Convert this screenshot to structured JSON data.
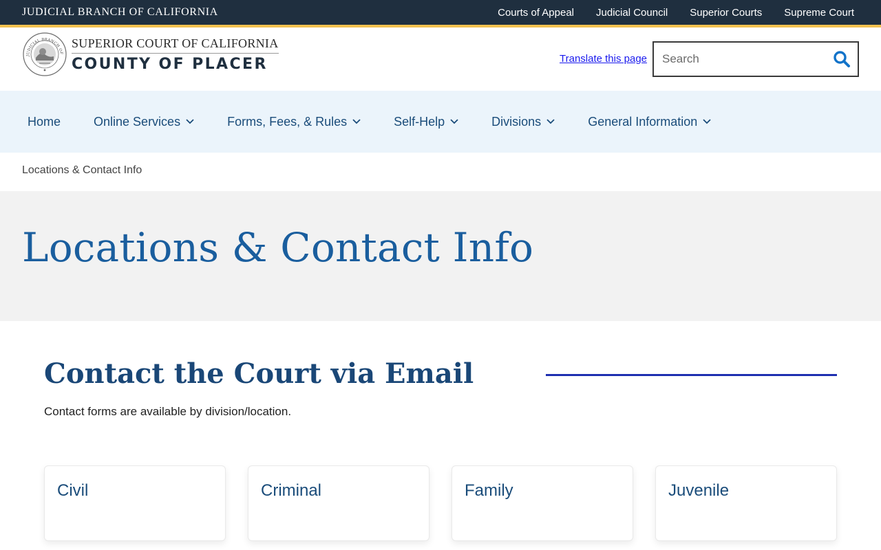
{
  "topbar": {
    "brand": "JUDICIAL BRANCH OF CALIFORNIA",
    "links": [
      "Courts of Appeal",
      "Judicial Council",
      "Superior Courts",
      "Supreme Court"
    ]
  },
  "header": {
    "logo_line1": "SUPERIOR COURT OF CALIFORNIA",
    "logo_line2": "COUNTY OF PLACER",
    "seal_text": "JUDICIAL BRANCH OF CALIFORNIA",
    "translate_label": "Translate this page",
    "search_placeholder": "Search"
  },
  "nav": {
    "items": [
      {
        "label": "Home"
      },
      {
        "label": "Online Services"
      },
      {
        "label": "Forms, Fees, & Rules"
      },
      {
        "label": "Self-Help"
      },
      {
        "label": "Divisions"
      },
      {
        "label": "General Information"
      }
    ]
  },
  "breadcrumb": "Locations & Contact Info",
  "hero": {
    "title": "Locations & Contact Info"
  },
  "section": {
    "title": "Contact the Court via Email",
    "description": "Contact forms are available by division/location."
  },
  "cards": [
    {
      "title": "Civil"
    },
    {
      "title": "Criminal"
    },
    {
      "title": "Family"
    },
    {
      "title": "Juvenile"
    }
  ],
  "colors": {
    "topbar": "#1f2f3f",
    "gold_accent": "#f2c14e",
    "nav_bg": "#ebf4fb",
    "link_blue": "#1a4c7a",
    "hero_title": "#1a5e9e",
    "search_icon": "#1273c9"
  },
  "icons": {
    "search": "search-icon",
    "nav_chevron": "chevron-down-icon",
    "seal": "court-seal-icon"
  }
}
